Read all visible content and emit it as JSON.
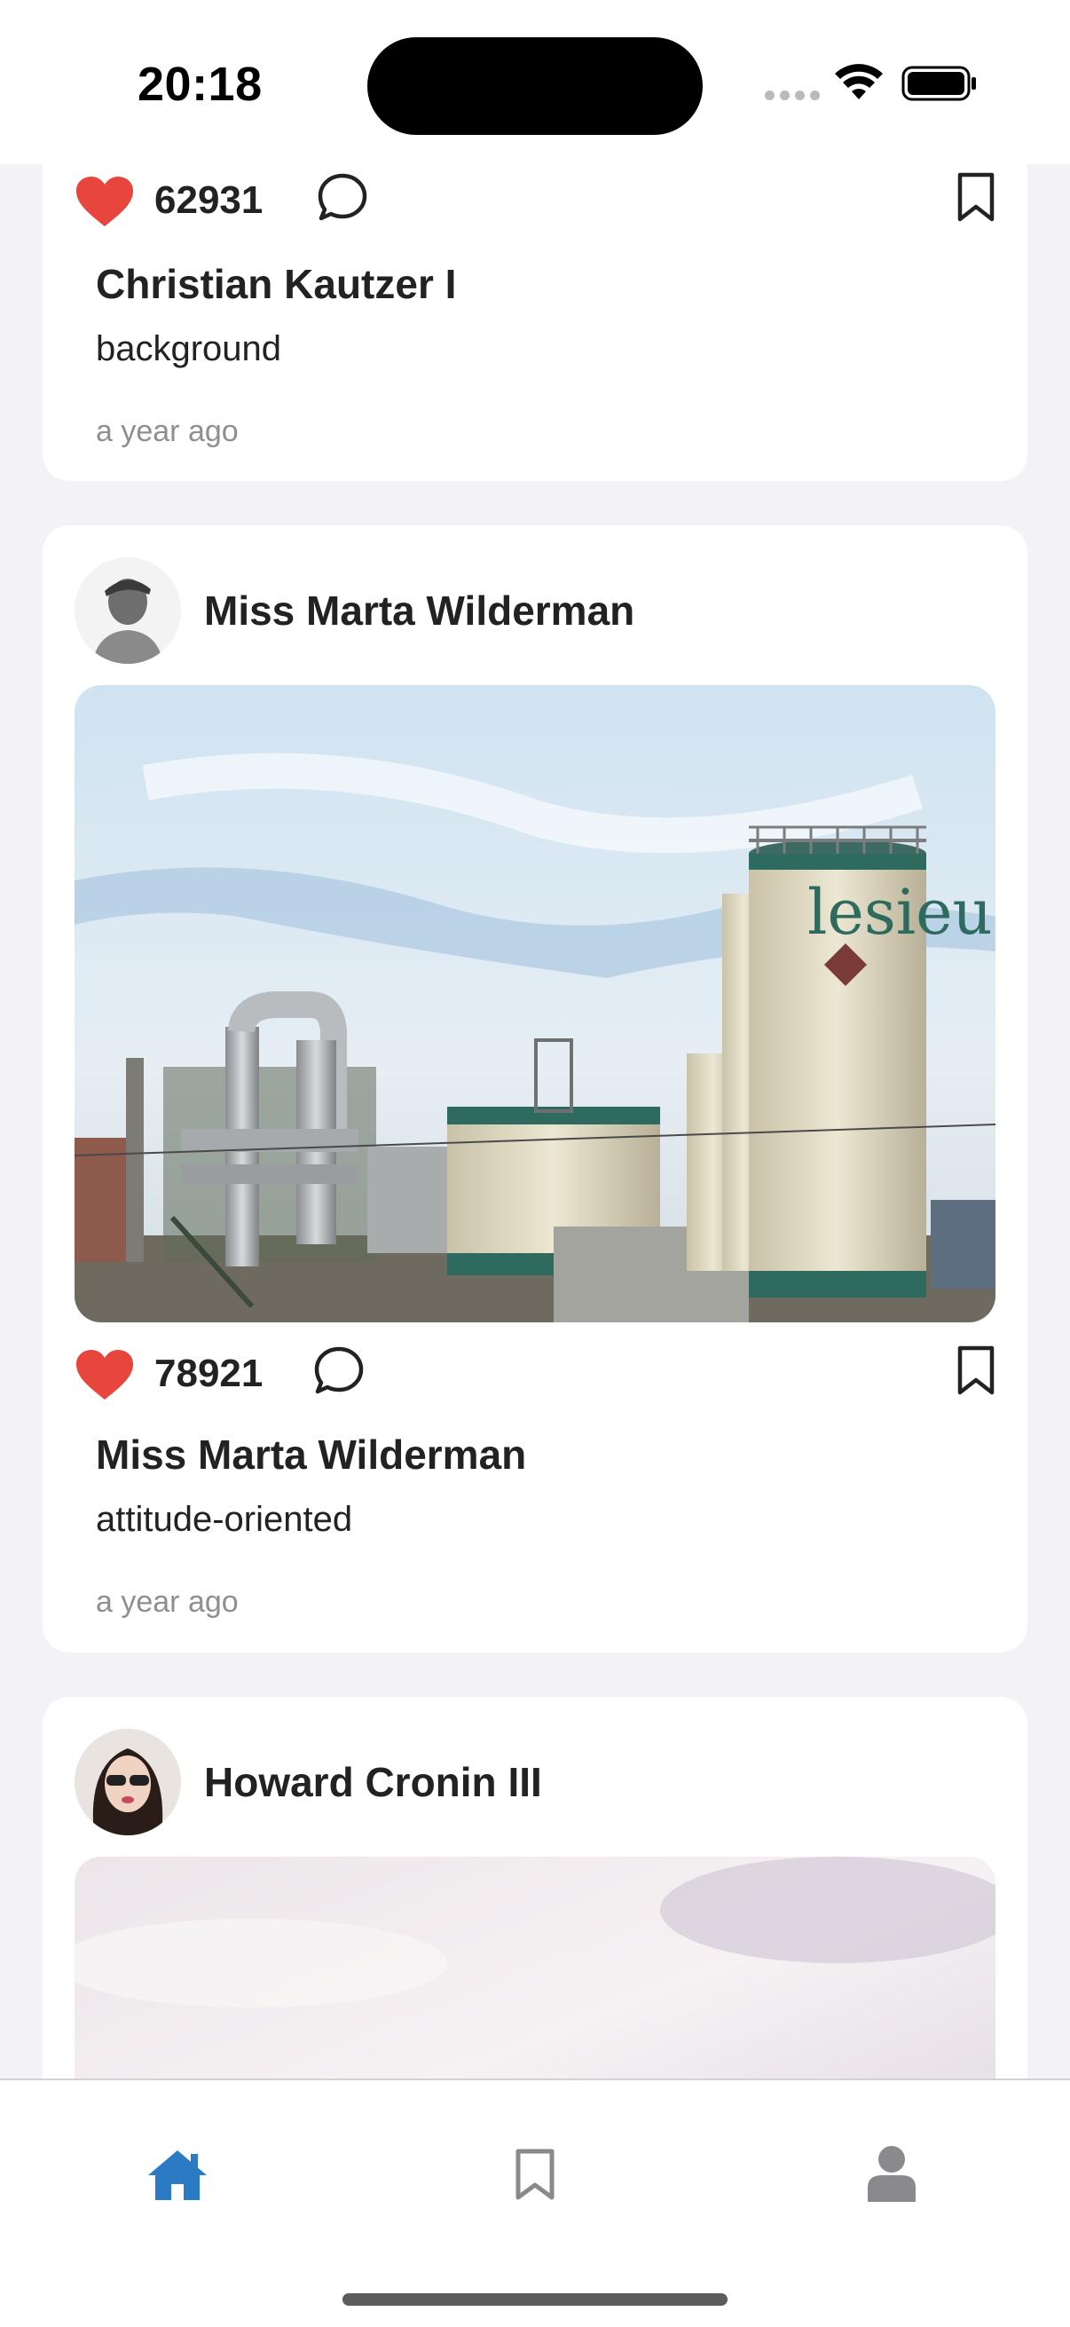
{
  "status_bar": {
    "time": "20:18"
  },
  "colors": {
    "accent": "#2b7bc4",
    "like": "#e8453c",
    "tab_inactive": "#8a8a8e"
  },
  "posts": [
    {
      "author": "Christian Kautzer I",
      "likes": "62931",
      "title": "Christian Kautzer I",
      "description": "background",
      "time": "a year ago",
      "liked": true
    },
    {
      "author": "Miss Marta Wilderman",
      "likes": "78921",
      "title": "Miss Marta Wilderman",
      "description": "attitude-oriented",
      "time": "a year ago",
      "liked": true,
      "image": {
        "tank_lettering": "lesieu"
      }
    },
    {
      "author": "Howard Cronin III"
    }
  ],
  "tab_bar": {
    "items": [
      {
        "icon": "home-icon",
        "active": true
      },
      {
        "icon": "bookmark-icon",
        "active": false
      },
      {
        "icon": "person-icon",
        "active": false
      }
    ]
  }
}
